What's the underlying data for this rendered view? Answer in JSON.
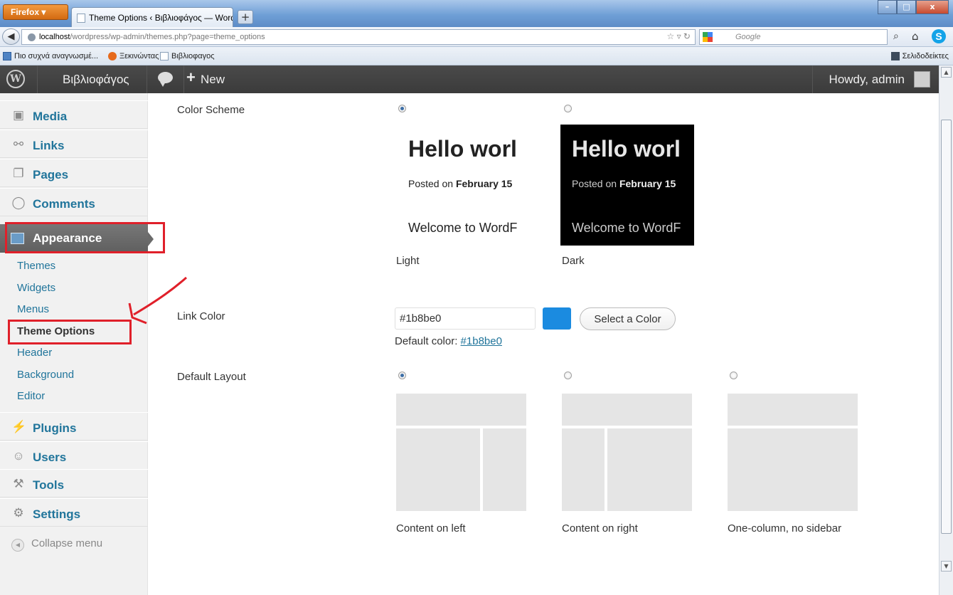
{
  "browser": {
    "app_button": "Firefox",
    "tab_title": "Theme Options ‹ Βιβλιοφάγος — WordP...",
    "new_tab": "+",
    "url_host": "localhost",
    "url_path": "/wordpress/wp-admin/themes.php?page=theme_options",
    "search_placeholder": "Google",
    "window_min": "–",
    "window_max": "□",
    "window_close": "x"
  },
  "bookmarks": {
    "items": [
      "Πιο συχνά αναγνωσμέ...",
      "Ξεκινώντας",
      "Βιβλιοφαγος"
    ],
    "right": "Σελιδοδείκτες"
  },
  "adminbar": {
    "site_name": "Βιβλιοφάγος",
    "new_label": "New",
    "howdy": "Howdy, admin"
  },
  "sidebar": {
    "items_above": [
      {
        "label": "Media",
        "icon": "media-icon"
      },
      {
        "label": "Links",
        "icon": "links-icon"
      },
      {
        "label": "Pages",
        "icon": "pages-icon"
      },
      {
        "label": "Comments",
        "icon": "comments-icon"
      }
    ],
    "appearance": "Appearance",
    "submenu": [
      "Themes",
      "Widgets",
      "Menus",
      "Theme Options",
      "Header",
      "Background",
      "Editor"
    ],
    "items_below": [
      {
        "label": "Plugins",
        "icon": "plugins-icon"
      },
      {
        "label": "Users",
        "icon": "users-icon"
      },
      {
        "label": "Tools",
        "icon": "tools-icon"
      },
      {
        "label": "Settings",
        "icon": "settings-icon"
      }
    ],
    "collapse": "Collapse menu"
  },
  "content": {
    "color_scheme": {
      "label": "Color Scheme",
      "preview_title": "Hello worl",
      "preview_posted_prefix": "Posted on",
      "preview_posted_date": "February 15",
      "preview_welcome": "Welcome to WordF",
      "options": [
        "Light",
        "Dark"
      ],
      "selected": "Light"
    },
    "link_color": {
      "label": "Link Color",
      "value": "#1b8be0",
      "swatch": "#1b8be0",
      "button": "Select a Color",
      "default_prefix": "Default color:",
      "default_value": "#1b8be0"
    },
    "default_layout": {
      "label": "Default Layout",
      "options": [
        "Content on left",
        "Content on right",
        "One-column, no sidebar"
      ],
      "selected": "Content on left"
    }
  }
}
